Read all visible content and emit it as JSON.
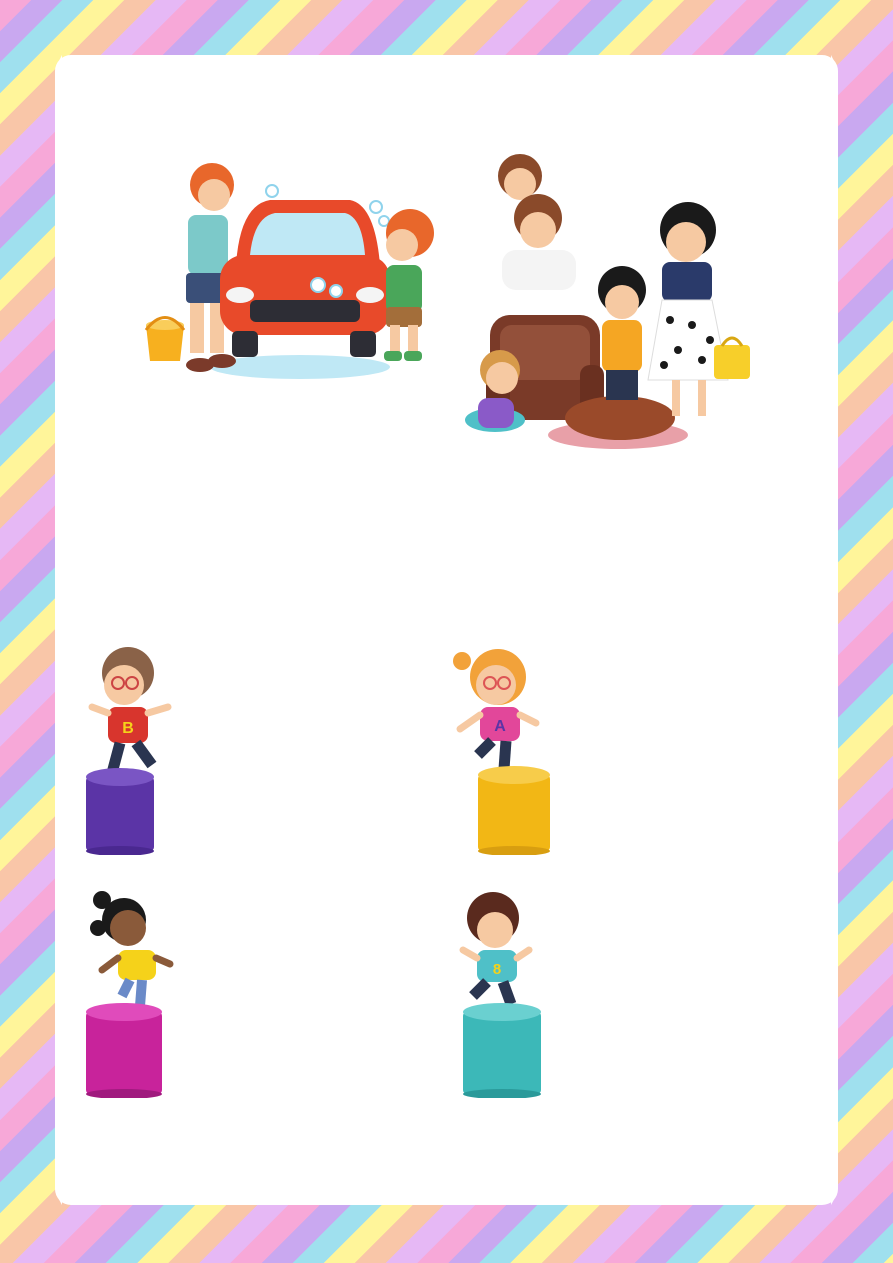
{
  "page": {
    "illustrations": [
      {
        "name": "car-wash-illustration"
      },
      {
        "name": "family-illustration"
      }
    ],
    "children": [
      {
        "name": "boy-letter-b",
        "letter": "B",
        "pedestal_color": "#5b34a6",
        "shirt_color": "#d8352d"
      },
      {
        "name": "girl-letter-a",
        "letter": "A",
        "pedestal_color": "#f2b715",
        "shirt_color": "#e2479a"
      },
      {
        "name": "girl-yellow-shirt",
        "letter": "",
        "pedestal_color": "#c8239b",
        "shirt_color": "#f5d21a"
      },
      {
        "name": "boy-number-8",
        "letter": "8",
        "pedestal_color": "#3cb8b8",
        "shirt_color": "#4fc0c8"
      }
    ]
  }
}
